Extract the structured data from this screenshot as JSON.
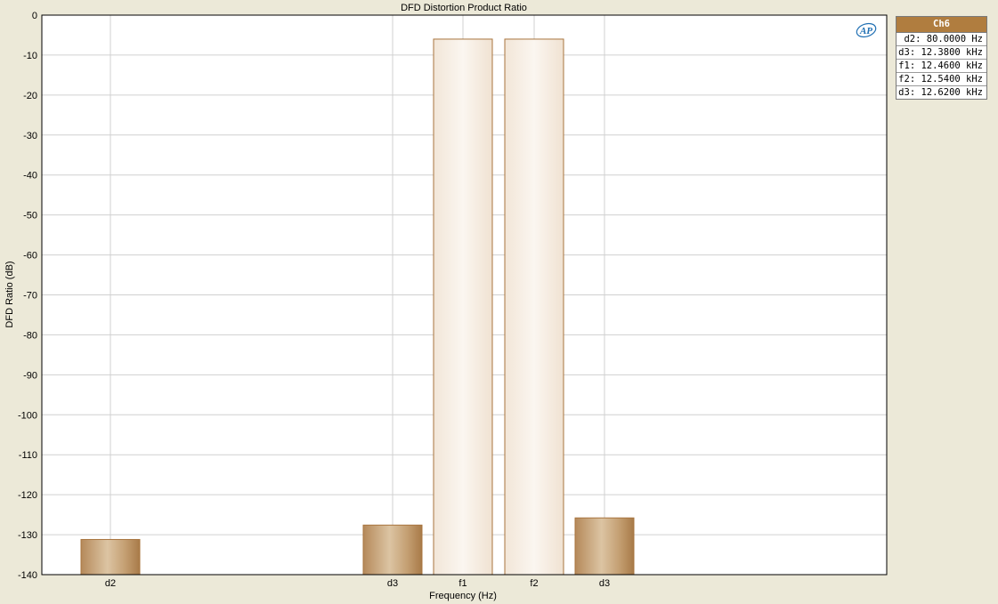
{
  "chart_data": {
    "type": "bar",
    "title": "DFD Distortion Product Ratio",
    "xlabel": "Frequency (Hz)",
    "ylabel": "DFD Ratio (dB)",
    "ylim": [
      -140,
      0
    ],
    "yticks": [
      0,
      -10,
      -20,
      -30,
      -40,
      -50,
      -60,
      -70,
      -80,
      -90,
      -100,
      -110,
      -120,
      -130,
      -140
    ],
    "grid": true,
    "bars": [
      {
        "label": "d2",
        "value": -131.2
      },
      {
        "label": "d3",
        "value": -127.6
      },
      {
        "label": "f1",
        "value": -6.0
      },
      {
        "label": "f2",
        "value": -6.0
      },
      {
        "label": "d3",
        "value": -125.8
      }
    ],
    "colors": {
      "distortion_bar": "#c09a6b",
      "tone_bar": "#f6ece2",
      "bar_edge": "#a8743e"
    }
  },
  "legend": {
    "header": "Ch6",
    "rows": [
      "d2: 80.0000 Hz",
      "d3: 12.3800 kHz",
      "f1: 12.4600 kHz",
      "f2: 12.5400 kHz",
      "d3: 12.6200 kHz"
    ],
    "header_color": "#b07d3f"
  },
  "logo": {
    "text": "AP",
    "color": "#1f6fb3"
  }
}
